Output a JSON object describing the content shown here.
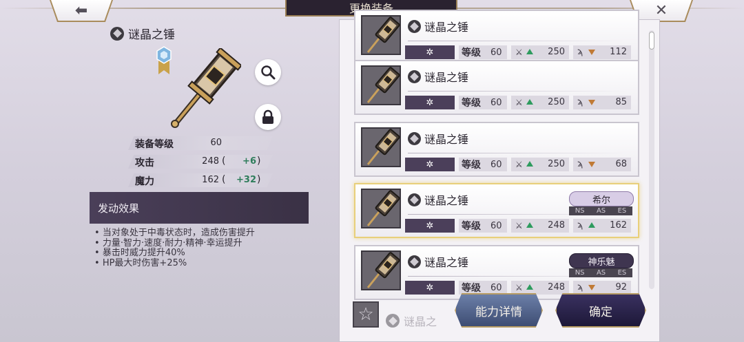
{
  "header": {
    "title": "更换装备",
    "back_label": "⬅",
    "close_label": "✕"
  },
  "item": {
    "name": "谜晶之锤",
    "stats": [
      {
        "label": "装备等级",
        "value": "60",
        "bonus": ""
      },
      {
        "label": "攻击",
        "value": "248",
        "bonus": "+6"
      },
      {
        "label": "魔力",
        "value": "162",
        "bonus": "+32"
      }
    ],
    "effect_title": "发动效果",
    "effects": [
      "当对象处于中毒状态时，造成伤害提升",
      "力量·智力·速度·耐力·精神·幸运提升",
      "暴击时威力提升40%",
      "HP最大时伤害+25%"
    ]
  },
  "list": {
    "level_label": "等级",
    "slot_glyph": "✲",
    "cards": [
      {
        "name": "谜晶之锤",
        "level": "60",
        "atk": "250",
        "atk_dir": "up",
        "mag": "112",
        "mag_dir": "down",
        "owner": "",
        "selected": false
      },
      {
        "name": "谜晶之锤",
        "level": "60",
        "atk": "250",
        "atk_dir": "up",
        "mag": "85",
        "mag_dir": "down",
        "owner": "",
        "selected": false
      },
      {
        "name": "谜晶之锤",
        "level": "60",
        "atk": "250",
        "atk_dir": "up",
        "mag": "68",
        "mag_dir": "down",
        "owner": "",
        "selected": false
      },
      {
        "name": "谜晶之锤",
        "level": "60",
        "atk": "248",
        "atk_dir": "up",
        "mag": "162",
        "mag_dir": "up",
        "owner": "希尔",
        "owner_style": "light",
        "selected": true
      },
      {
        "name": "谜晶之锤",
        "level": "60",
        "atk": "248",
        "atk_dir": "up",
        "mag": "92",
        "mag_dir": "down",
        "owner": "神乐魅",
        "owner_style": "dark",
        "selected": false
      }
    ],
    "partial_next_name": "谜晶之",
    "tags": [
      "NS",
      "AS",
      "ES"
    ]
  },
  "buttons": {
    "detail": "能力详情",
    "confirm": "确定"
  },
  "colors": {
    "accent_gold": "#b79c63",
    "up_green": "#2e9b5e",
    "down_orange": "#c07a35",
    "panel_purple": "#4a3f59"
  }
}
